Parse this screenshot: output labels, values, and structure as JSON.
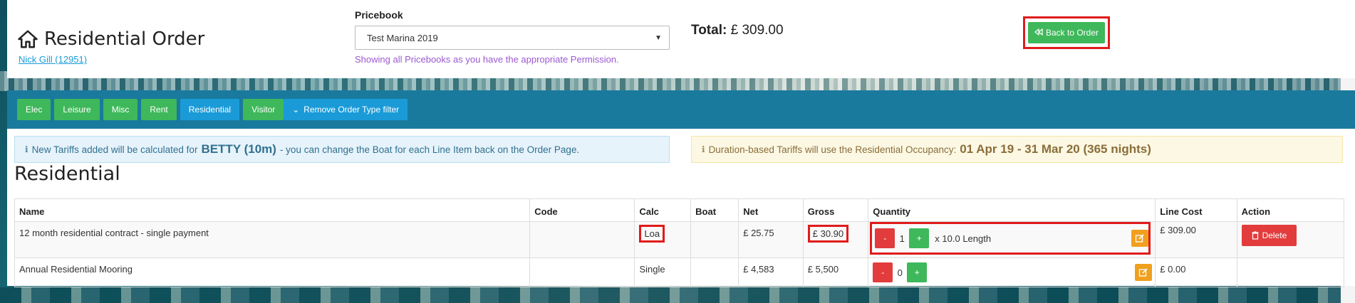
{
  "header": {
    "title": "Residential Order",
    "user_link": "Nick Gill (12951)",
    "pricebook_label": "Pricebook",
    "pricebook_value": "Test Marina 2019",
    "pricebook_note": "Showing all Pricebooks as you have the appropriate Permission.",
    "total_label": "Total:",
    "total_value": "£ 309.00",
    "back_button": "Back to Order"
  },
  "filters": {
    "buttons": [
      {
        "label": "Elec",
        "color": "green"
      },
      {
        "label": "Leisure",
        "color": "green"
      },
      {
        "label": "Misc",
        "color": "green"
      },
      {
        "label": "Rent",
        "color": "green"
      },
      {
        "label": "Residential",
        "color": "blue"
      },
      {
        "label": "Visitor",
        "color": "green"
      }
    ],
    "remove_label": "Remove Order Type filter"
  },
  "alerts": {
    "info_prefix": "New Tariffs added will be calculated for",
    "info_boat": "BETTY (10m)",
    "info_suffix": "- you can change the Boat for each Line Item back on the Order Page.",
    "warn_prefix": "Duration-based Tariffs will use the Residential Occupancy:",
    "warn_occupancy": "01 Apr 19 - 31 Mar 20 (365 nights)"
  },
  "section_title": "Residential",
  "table": {
    "columns": [
      "Name",
      "Code",
      "Calc",
      "Boat",
      "Net",
      "Gross",
      "Quantity",
      "Line Cost",
      "Action"
    ],
    "rows": [
      {
        "name": "12 month residential contract - single payment",
        "code": "",
        "calc": "Loa",
        "boat": "",
        "net": "£ 25.75",
        "gross": "£ 30.90",
        "qty_minus": "-",
        "qty_value": "1",
        "qty_plus": "+",
        "qty_unit": "x 10.0 Length",
        "line_cost": "£ 309.00",
        "action": "Delete"
      },
      {
        "name": "Annual Residential Mooring",
        "code": "",
        "calc": "Single",
        "boat": "",
        "net": "£ 4,583",
        "gross": "£ 5,500",
        "qty_minus": "-",
        "qty_value": "0",
        "qty_plus": "+",
        "qty_unit": "",
        "line_cost": "£ 0.00",
        "action": ""
      }
    ]
  },
  "colors": {
    "green": "#3eb85a",
    "blue": "#1a9bd8",
    "filter_bar": "#1a7a9e",
    "danger": "#e23c3c",
    "warning": "#f0a01e",
    "highlight": "#e01b1b"
  }
}
